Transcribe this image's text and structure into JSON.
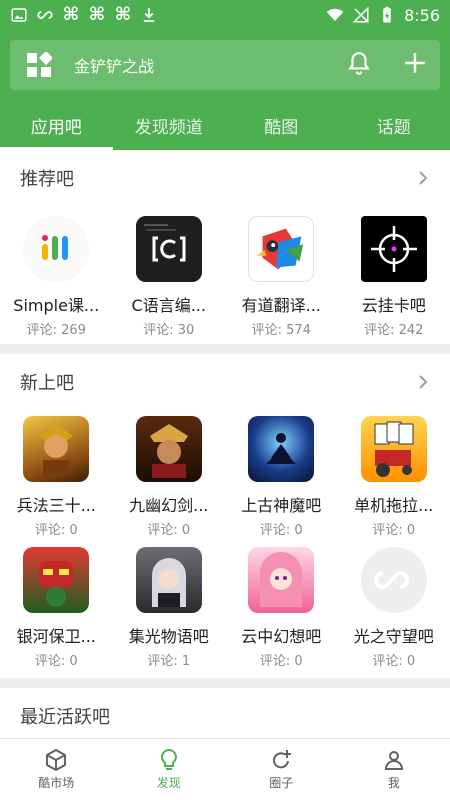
{
  "status_bar": {
    "time": "8:56",
    "left_icons": [
      "image-icon",
      "infinity-icon",
      "app-icon",
      "app-icon",
      "app-icon",
      "download-icon"
    ],
    "right_icons": [
      "wifi-icon",
      "signal-off-icon",
      "battery-charging-icon"
    ]
  },
  "header": {
    "title": "金铲铲之战",
    "colors": {
      "primary": "#4caf50",
      "search_bg": "#6cbd6f"
    }
  },
  "tabs": [
    {
      "label": "应用吧",
      "active": true
    },
    {
      "label": "发现频道",
      "active": false
    },
    {
      "label": "酷图",
      "active": false
    },
    {
      "label": "话题",
      "active": false
    }
  ],
  "sections": {
    "recommended": {
      "title": "推荐吧",
      "items": [
        {
          "name": "Simple课...",
          "meta": "评论: 269"
        },
        {
          "name": "C语言编...",
          "meta": "评论: 30"
        },
        {
          "name": "有道翻译...",
          "meta": "评论: 574"
        },
        {
          "name": "云挂卡吧",
          "meta": "评论: 242"
        }
      ]
    },
    "new": {
      "title": "新上吧",
      "items": [
        {
          "name": "兵法三十...",
          "meta": "评论: 0"
        },
        {
          "name": "九幽幻剑...",
          "meta": "评论: 0"
        },
        {
          "name": "上古神魔吧",
          "meta": "评论: 0"
        },
        {
          "name": "单机拖拉...",
          "meta": "评论: 0"
        },
        {
          "name": "银河保卫...",
          "meta": "评论: 0"
        },
        {
          "name": "集光物语吧",
          "meta": "评论: 1"
        },
        {
          "name": "云中幻想吧",
          "meta": "评论: 0"
        },
        {
          "name": "光之守望吧",
          "meta": "评论: 0"
        }
      ]
    },
    "active": {
      "title": "最近活跃吧"
    }
  },
  "bottom_nav": [
    {
      "label": "酷市场",
      "icon": "cube-icon",
      "active": false
    },
    {
      "label": "发现",
      "icon": "lightbulb-icon",
      "active": true
    },
    {
      "label": "圈子",
      "icon": "refresh-plus-icon",
      "active": false
    },
    {
      "label": "我",
      "icon": "person-icon",
      "active": false
    }
  ]
}
